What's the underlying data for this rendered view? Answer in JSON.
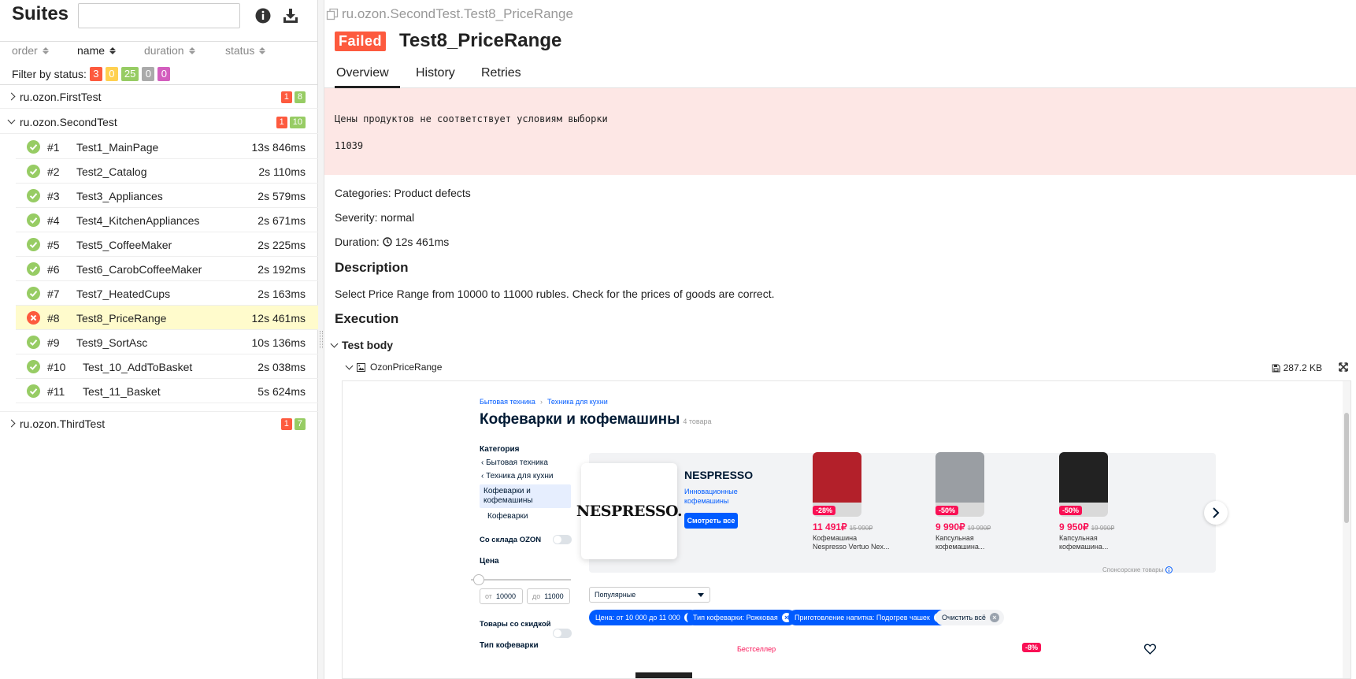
{
  "left": {
    "title": "Suites",
    "search_placeholder": "",
    "sort": {
      "order": "order",
      "name": "name",
      "duration": "duration",
      "status": "status"
    },
    "filter": {
      "label": "Filter by status:",
      "failed": "3",
      "broken": "0",
      "passed": "25",
      "skipped": "0",
      "unknown": "0"
    },
    "groups": [
      {
        "name": "ru.ozon.FirstTest",
        "failed": "1",
        "passed": "8",
        "expanded": false
      },
      {
        "name": "ru.ozon.SecondTest",
        "failed": "1",
        "passed": "10",
        "expanded": true
      },
      {
        "name": "ru.ozon.ThirdTest",
        "failed": "1",
        "passed": "7",
        "expanded": false
      }
    ],
    "tests": [
      {
        "num": "#1",
        "name": "Test1_MainPage",
        "duration": "13s 846ms",
        "status": "passed"
      },
      {
        "num": "#2",
        "name": "Test2_Catalog",
        "duration": "2s 110ms",
        "status": "passed"
      },
      {
        "num": "#3",
        "name": "Test3_Appliances",
        "duration": "2s 579ms",
        "status": "passed"
      },
      {
        "num": "#4",
        "name": "Test4_KitchenAppliances",
        "duration": "2s 671ms",
        "status": "passed"
      },
      {
        "num": "#5",
        "name": "Test5_CoffeeMaker",
        "duration": "2s 225ms",
        "status": "passed"
      },
      {
        "num": "#6",
        "name": "Test6_CarobCoffeeMaker",
        "duration": "2s 192ms",
        "status": "passed"
      },
      {
        "num": "#7",
        "name": "Test7_HeatedCups",
        "duration": "2s 163ms",
        "status": "passed"
      },
      {
        "num": "#8",
        "name": "Test8_PriceRange",
        "duration": "12s 461ms",
        "status": "failed"
      },
      {
        "num": "#9",
        "name": "Test9_SortAsc",
        "duration": "10s 136ms",
        "status": "passed"
      },
      {
        "num": "#10",
        "name": "Test_10_AddToBasket",
        "duration": "2s 038ms",
        "status": "passed"
      },
      {
        "num": "#11",
        "name": "Test_11_Basket",
        "duration": "5s 624ms",
        "status": "passed"
      }
    ]
  },
  "right": {
    "breadcrumb": "ru.ozon.SecondTest.Test8_PriceRange",
    "status_label": "Failed",
    "test_title": "Test8_PriceRange",
    "tabs": [
      "Overview",
      "History",
      "Retries"
    ],
    "error": {
      "message": "Цены продуктов не соответствует условиям выборки",
      "value": "11039"
    },
    "categories_label": "Categories:",
    "categories_value": "Product defects",
    "severity_label": "Severity:",
    "severity_value": "normal",
    "duration_label": "Duration:",
    "duration_value": "12s 461ms",
    "description_heading": "Description",
    "description_text": "Select Price Range from 10000 to 11000 rubles. Check for the prices of goods are correct.",
    "execution_heading": "Execution",
    "step_name": "Test body",
    "attachment_name": "OzonPriceRange",
    "attachment_size": "287.2 KB"
  },
  "screenshot": {
    "crumb1": "Бытовая техника",
    "crumb2": "Техника для кухни",
    "title": "Кофеварки и кофемашины",
    "count": "4 товара",
    "category_heading": "Категория",
    "cat_back1": "Бытовая техника",
    "cat_back2": "Техника для кухни",
    "cat_selected": "Кофеварки и кофемашины",
    "cat_sub": "Кофеварки",
    "warehouse_label": "Со склада OZON",
    "price_heading": "Цена",
    "price_from_ph": "от",
    "price_from": "10000",
    "price_to_ph": "до",
    "price_to": "11000",
    "discount_label": "Товары со скидкой",
    "coffee_type_heading": "Тип кофеварки",
    "brand_logo": "NESPRESSO.",
    "brand_name": "NESPRESSO",
    "brand_tagline": "Инновационные кофемашины",
    "brand_button": "Смотреть все",
    "products": [
      {
        "disc": "-28%",
        "price": "11 491₽",
        "old": "15 990₽",
        "name1": "Кофемашина",
        "name2": "Nespresso Vertuo Nex...",
        "color": "#b3202a"
      },
      {
        "disc": "-50%",
        "price": "9 990₽",
        "old": "19 990₽",
        "name1": "Капсульная",
        "name2": "кофемашина...",
        "color": "#9a9ea3"
      },
      {
        "disc": "-50%",
        "price": "9 950₽",
        "old": "19 990₽",
        "name1": "Капсульная",
        "name2": "кофемашина...",
        "color": "#222222"
      }
    ],
    "sponsored": "Спонсорские товары",
    "sort_value": "Популярные",
    "chips": [
      "Цена: от 10 000 до 11 000",
      "Тип кофеварки: Рожковая",
      "Приготовление напитка: Подогрев чашек"
    ],
    "clear_all": "Очистить всё",
    "bestseller": "Бестселлер",
    "bottom_disc": "-8%"
  }
}
